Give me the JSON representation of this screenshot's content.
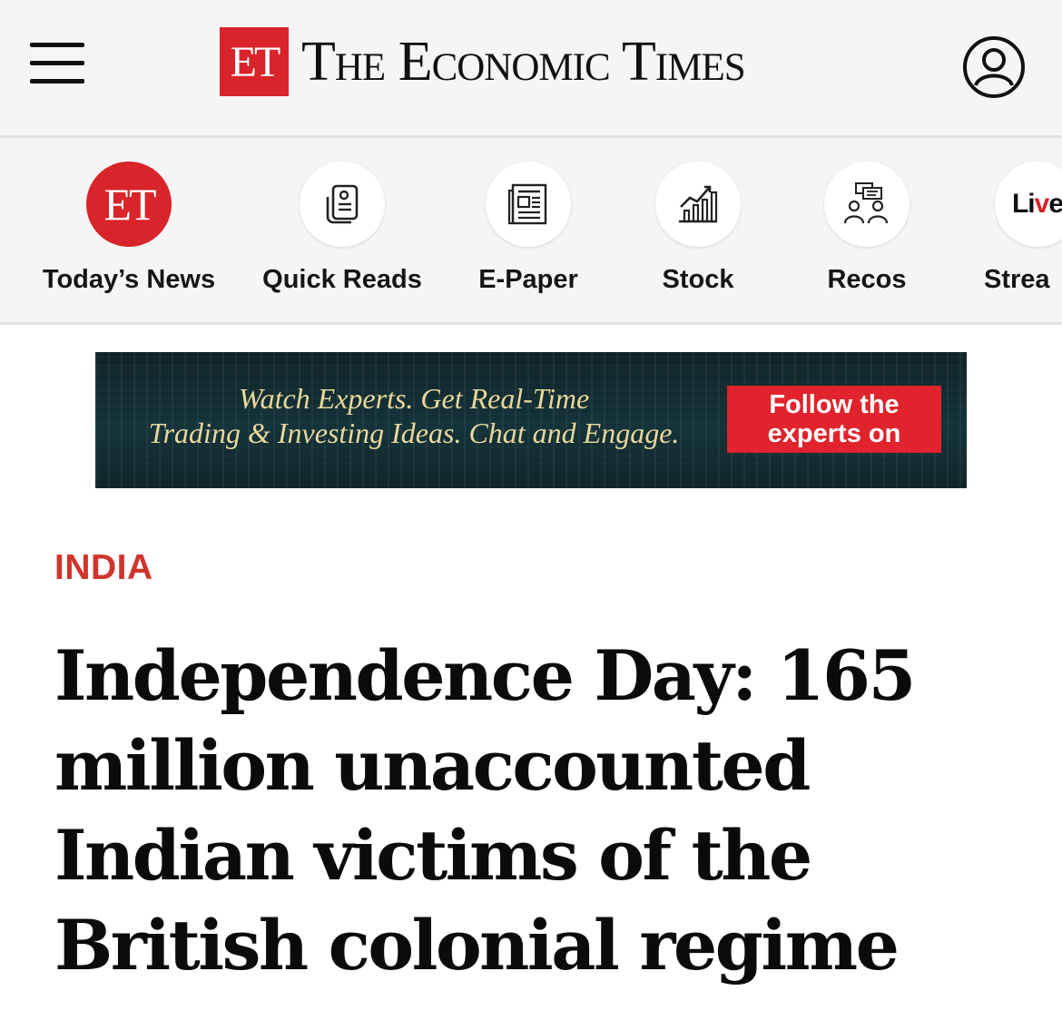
{
  "header": {
    "logo_badge": "ET",
    "logo_text": "The Economic Times"
  },
  "quick_nav": [
    {
      "label": "Today’s News",
      "icon": "et-logo-icon",
      "badge": "ET"
    },
    {
      "label": "Quick Reads",
      "icon": "quick-reads-icon"
    },
    {
      "label": "E-Paper",
      "icon": "newspaper-icon"
    },
    {
      "label": "Stock",
      "icon": "stock-chart-icon"
    },
    {
      "label": "Recos",
      "icon": "experts-icon"
    },
    {
      "label": "Strea",
      "icon": "live-icon",
      "badge_prefix": "Li",
      "badge_v": "v",
      "badge_suffix": "e"
    }
  ],
  "ad": {
    "line1": "Watch Experts. Get Real-Time",
    "line2": "Trading & Investing Ideas. Chat and Engage.",
    "cta_line1": "Follow the",
    "cta_line2": "experts on"
  },
  "article": {
    "section": "INDIA",
    "headline_lines": [
      "Independence Day: 165",
      "million unaccounted",
      "Indian victims of the",
      "British colonial regime"
    ]
  },
  "colors": {
    "brand_red": "#d8242a",
    "section_red": "#d0342c",
    "ad_bg": "#14333a",
    "ad_gold": "#e9d89b",
    "cta_red": "#e0232c"
  }
}
